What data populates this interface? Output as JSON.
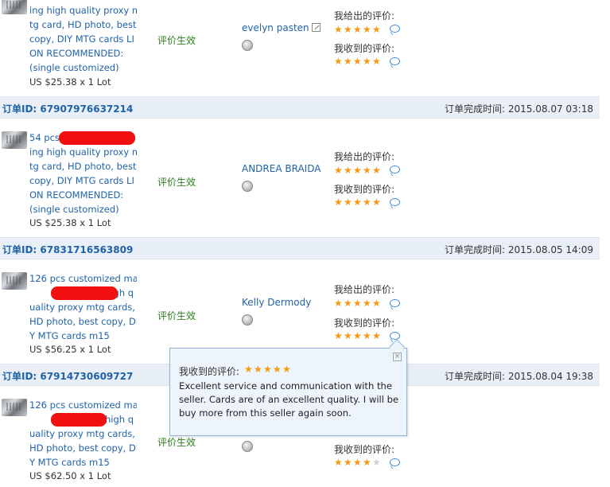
{
  "ratings_label_given": "我给出的评价:",
  "ratings_label_received": "我收到的评价:",
  "order_id_label": "订单ID:",
  "order_time_label": "订单完成时间:",
  "status_text": "评价生效",
  "orders": [
    {
      "order_id": "",
      "completed": "",
      "product_lines": [
        "ing high quality proxy m",
        "tg card, HD photo, best",
        "copy, DIY MTG cards LI",
        "ON RECOMMENDED:",
        "(single customized)"
      ],
      "price": "US $25.38 x 1 Lot",
      "buyer": "evelyn pasten",
      "given_stars": 5,
      "received_stars": 5
    },
    {
      "order_id": "67907976637214",
      "completed": "2015.08.07 03:18",
      "product_lines": [
        "54 pcs",
        "ing high quality proxy m",
        "tg card, HD photo, best",
        "copy, DIY MTG cards LI",
        "ON RECOMMENDED:",
        "(single customized)"
      ],
      "price": "US $25.38 x 1 Lot",
      "buyer": "ANDREA BRAIDA",
      "given_stars": 5,
      "received_stars": 5
    },
    {
      "order_id": "67831716563809",
      "completed": "2015.08.05 14:09",
      "product_lines": [
        "126 pcs customized ma",
        "high q",
        "uality proxy mtg cards,",
        "HD photo, best copy, DI",
        "Y MTG cards m15"
      ],
      "price": "US $56.25 x 1 Lot",
      "buyer": "Kelly Dermody",
      "given_stars": 5,
      "received_stars": 5
    },
    {
      "order_id": "67914730609727",
      "completed": "2015.08.04 19:38",
      "product_lines": [
        "126 pcs customized ma",
        "high q",
        "uality proxy mtg cards,",
        "HD photo, best copy, DI",
        "Y MTG cards m15"
      ],
      "price": "US $62.50 x 1 Lot",
      "buyer": "",
      "given_stars": 0,
      "received_stars": 4
    }
  ],
  "popup": {
    "title": "我收到的评价:",
    "stars": 5,
    "body": "Excellent service and communication with the seller. Cards are of an excellent quality. I will be buy more from this seller again soon.",
    "close_symbol": "×"
  },
  "colors": {
    "link": "#1f62a8",
    "status_green": "#2f7d1e",
    "star_orange": "#f39a12",
    "order_bar": "#e9eff6"
  }
}
